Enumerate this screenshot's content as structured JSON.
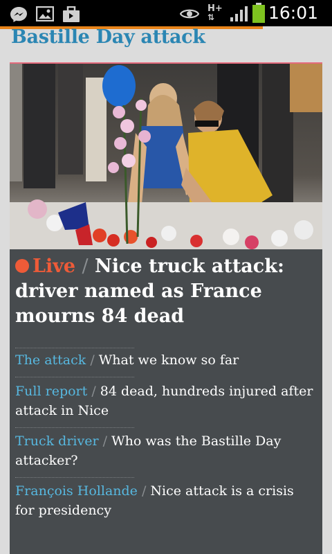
{
  "status_bar": {
    "time": "16:01",
    "network": "H+",
    "icons": [
      "messenger-icon",
      "gallery-icon",
      "briefcase-icon",
      "eye-icon",
      "signal-icon",
      "battery-icon"
    ],
    "battery_color": "#7ec21f"
  },
  "section": {
    "title": "Bastille Day attack"
  },
  "lead": {
    "live_label": "Live",
    "separator": "/",
    "headline": "Nice truck attack: driver named as France mourns 84 dead",
    "image_alt": "Mourners laying flowers at a memorial"
  },
  "related": [
    {
      "kicker": "The attack",
      "separator": "/",
      "text": "What we know so far"
    },
    {
      "kicker": "Full report",
      "separator": "/",
      "text": "84 dead, hundreds injured after attack in Nice"
    },
    {
      "kicker": "Truck driver",
      "separator": "/",
      "text": "Who was the Bastille Day attacker?"
    },
    {
      "kicker": "François Hollande",
      "separator": "/",
      "text": "Nice attack is a crisis for presidency"
    }
  ],
  "colors": {
    "accent_blue": "#2b86b3",
    "kicker_blue": "#57b8e0",
    "live_orange": "#ee5b38",
    "card_bg": "#474b4e",
    "page_bg": "#dcdcdc"
  }
}
